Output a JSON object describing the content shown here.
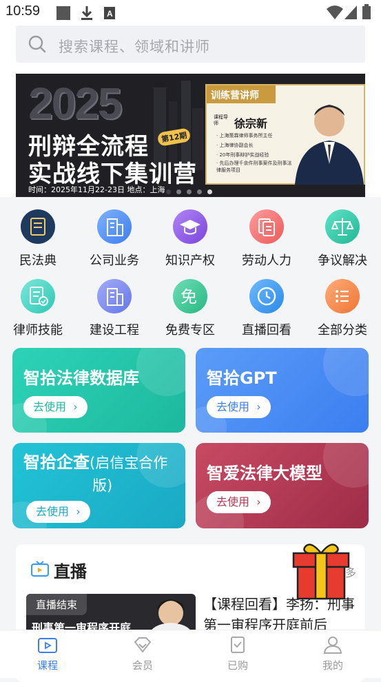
{
  "status_bar": {
    "time": "10:59"
  },
  "search": {
    "placeholder": "搜索课程、领域和讲师"
  },
  "banner": {
    "year": "2025",
    "line1": "刑辩全流程",
    "line2": "实战线下集训营",
    "edition": "第12期",
    "meta": "时间：2025年11月22-23日 地点：上海",
    "card_title": "训练营讲师",
    "teacher_label": "课程导师",
    "teacher": "徐宗新",
    "bullets": [
      "· 上海策霖律师事务所主任",
      "· 上海律协副会长",
      "· 20年刑事辩护实战经验",
      "· 先后办理千余件刑事案件及刑事法律服务项目"
    ]
  },
  "categories": [
    {
      "label": "民法典",
      "icon": "book-icon",
      "color": "#1e3a5f"
    },
    {
      "label": "公司业务",
      "icon": "building-icon",
      "color": "#5b8def"
    },
    {
      "label": "知识产权",
      "icon": "graduation-cap-icon",
      "color": "#8f5ce6"
    },
    {
      "label": "劳动人力",
      "icon": "documents-icon",
      "color": "#f06b6b"
    },
    {
      "label": "争议解决",
      "icon": "scales-icon",
      "color": "#2ec7a6"
    },
    {
      "label": "律师技能",
      "icon": "checklist-icon",
      "color": "#3fd4c0"
    },
    {
      "label": "建设工程",
      "icon": "building-icon",
      "color": "#7e8df0"
    },
    {
      "label": "免费专区",
      "icon": "free-icon",
      "color": "#3cc79b"
    },
    {
      "label": "直播回看",
      "icon": "replay-clock-icon",
      "color": "#3c9cf2"
    },
    {
      "label": "全部分类",
      "icon": "list-icon",
      "color": "#f5874b"
    }
  ],
  "tools": [
    {
      "title": "智拾法律数据库",
      "button": "去使用",
      "color_start": "#2dd3b7",
      "color_end": "#1db89e",
      "btn_color": "#1db89e"
    },
    {
      "title": "智拾GPT",
      "button": "去使用",
      "color_start": "#5b9cf8",
      "color_end": "#3b7ef0",
      "btn_color": "#3b7ef0"
    },
    {
      "title": "智拾企查",
      "title_suffix_line1": "(启信宝合作",
      "title_suffix_line2": "版)",
      "button": "去使用",
      "color_start": "#22c3d6",
      "color_end": "#1aa9c4",
      "btn_color": "#1aa9c4"
    },
    {
      "title": "智爱法律大模型",
      "button": "去使用",
      "color_start": "#c84a63",
      "color_end": "#9e2c47",
      "btn_color": "#b03a55"
    }
  ],
  "live": {
    "title": "直播",
    "status": "直播结束",
    "thumb_text": "刑事第一审程序开庭",
    "description": "【课程回看】李扬：刑事第一审程序开庭前后",
    "more": "多"
  },
  "tabs": [
    {
      "label": "课程",
      "icon": "video-icon",
      "active": true
    },
    {
      "label": "会员",
      "icon": "diamond-icon",
      "active": false
    },
    {
      "label": "已购",
      "icon": "purchased-icon",
      "active": false
    },
    {
      "label": "我的",
      "icon": "user-icon",
      "active": false
    }
  ],
  "colors": {
    "accent": "#3b7ef0",
    "inactive": "#999999"
  }
}
